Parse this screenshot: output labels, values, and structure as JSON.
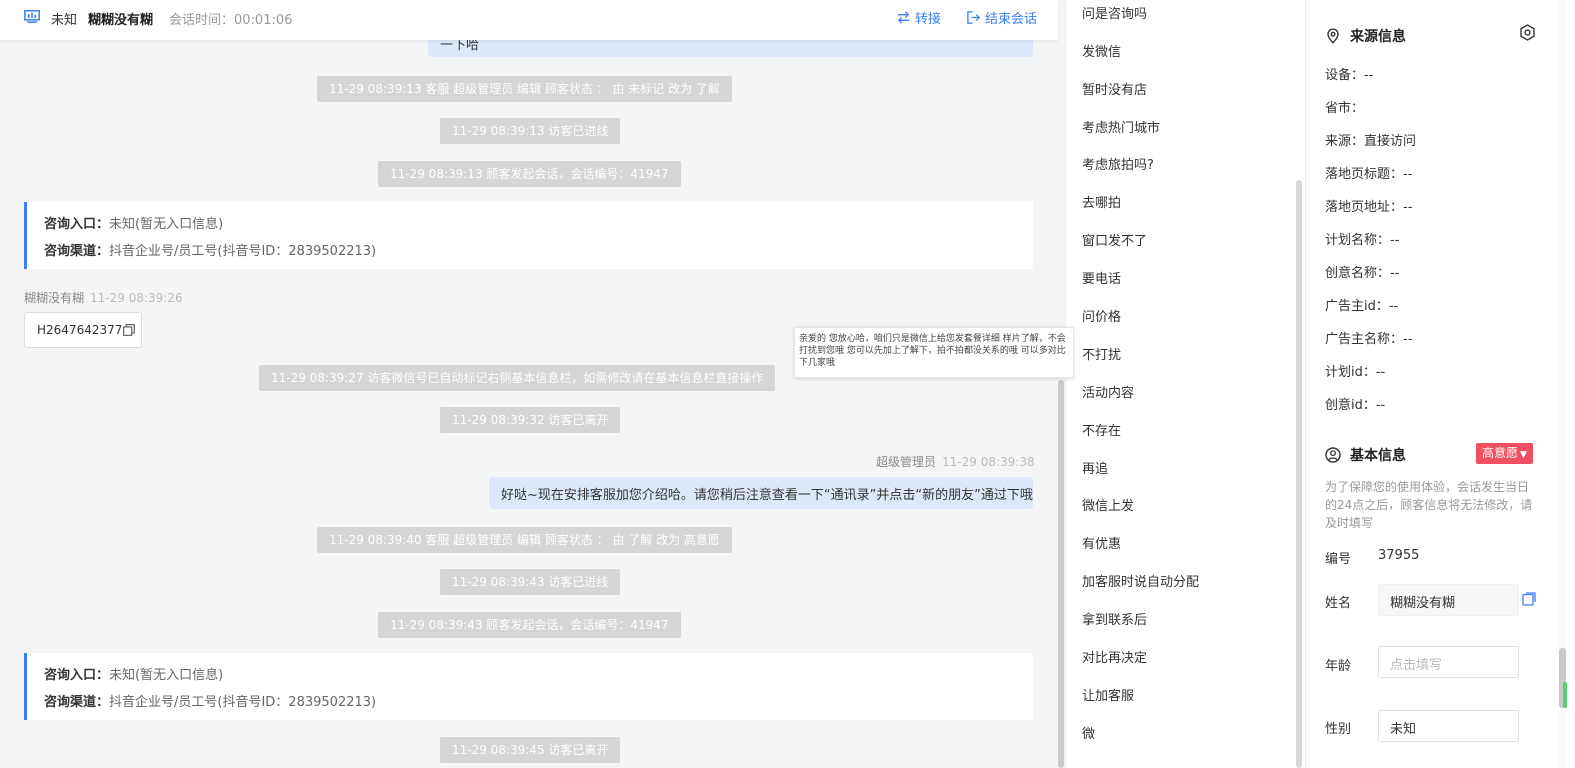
{
  "header": {
    "status": "未知",
    "visitor_name": "糊糊没有糊",
    "timer": "会话时间：00:01:06",
    "transfer_label": "转接",
    "end_label": "结束会话",
    "accent": "#3a7ff6"
  },
  "chat": {
    "top_bubble": "一下哈",
    "events": [
      "11-29 08:39:13 客服 超级管理员 编辑 顾客状态 ： 由 未标记 改为 了解",
      "11-29 08:39:13 访客已进线",
      "11-29 08:39:13 顾客发起会话，会话编号：41947",
      "11-29 08:39:27 访客微信号已自动标记右侧基本信息栏，如需修改请在基本信息栏直接操作",
      "11-29 08:39:32 访客已离开",
      "11-29 08:39:40 客服 超级管理员 编辑 顾客状态 ： 由 了解 改为 高意愿",
      "11-29 08:39:43 访客已进线",
      "11-29 08:39:43 顾客发起会话，会话编号：41947",
      "11-29 08:39:45 访客已离开"
    ],
    "cards": [
      {
        "entry_label": "咨询入口：",
        "entry_value": "未知(暂无入口信息)",
        "channel_label": "咨询渠道：",
        "channel_value": "抖音企业号/员工号(抖音号ID：2839502213)"
      },
      {
        "entry_label": "咨询入口：",
        "entry_value": "未知(暂无入口信息)",
        "channel_label": "咨询渠道：",
        "channel_value": "抖音企业号/员工号(抖音号ID：2839502213)"
      }
    ],
    "visitor_msg": {
      "sender": "糊糊没有糊",
      "time": "11-29 08:39:26",
      "text": "H2647642377"
    },
    "agent_msg": {
      "sender": "超级管理员",
      "time": "11-29 08:39:38",
      "text": "好哒~现在安排客服加您介绍哈。请您稍后注意查看一下“通讯录”并点击“新的朋友”通过下哦"
    },
    "tooltip": "亲爱的 您放心哈，咱们只是微信上给您发套餐详细 样片了解，不会打扰到您哦 您可以先加上了解下，拍不拍都没关系的哦 可以多对比下几家哦"
  },
  "quick_replies": [
    "问是咨询吗",
    "发微信",
    "暂时没有店",
    "考虑热门城市",
    "考虑旅拍吗?",
    "去哪拍",
    "窗口发不了",
    "要电话",
    "问价格",
    "不打扰",
    "活动内容",
    "不存在",
    "再追",
    "微信上发",
    "有优惠",
    "加客服时说自动分配",
    "拿到联系后",
    "对比再决定",
    "让加客服",
    "微"
  ],
  "info": {
    "source_title": "来源信息",
    "source_rows": [
      "设备：--",
      "省市：",
      "来源：直接访问",
      "落地页标题：--",
      "落地页地址：--",
      "计划名称：--",
      "创意名称：--",
      "广告主id：--",
      "广告主名称：--",
      "计划id：--",
      "创意id：--"
    ],
    "basic_title": "基本信息",
    "intent_badge": "高意愿",
    "badge_color": "#f05061",
    "notice": "为了保障您的使用体验，会话发生当日的24点之后，顾客信息将无法修改，请及时填写",
    "id_label": "编号",
    "id_value": "37955",
    "name_label": "姓名",
    "name_value": "糊糊没有糊",
    "age_label": "年龄",
    "age_placeholder": "点击填写",
    "gender_label": "性别",
    "gender_value": "未知"
  }
}
